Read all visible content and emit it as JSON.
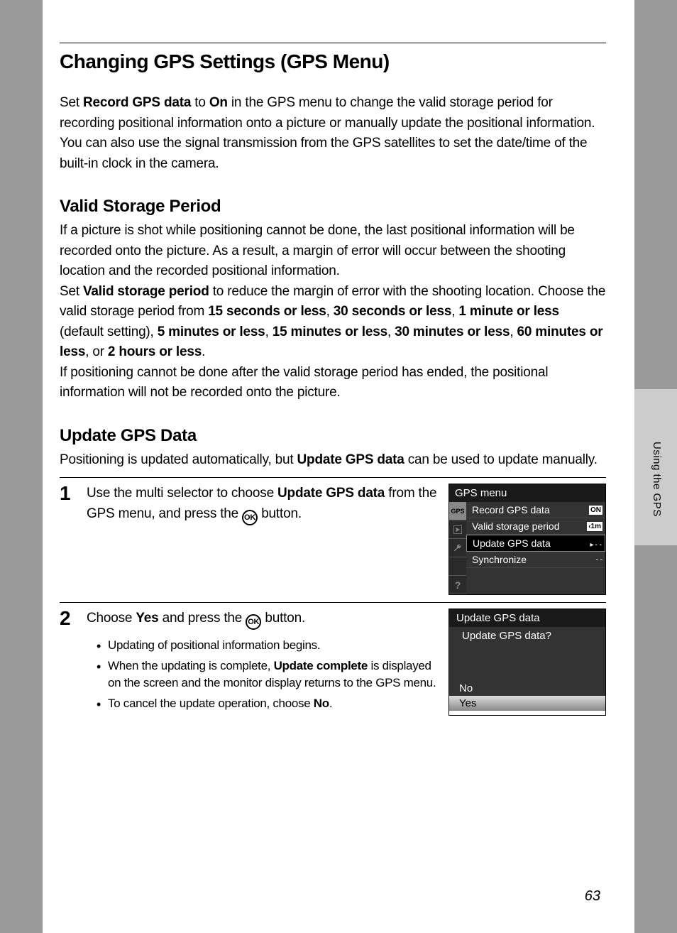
{
  "title": "Changing GPS Settings (GPS Menu)",
  "intro": {
    "pre": "Set ",
    "b1": "Record GPS data",
    "mid1": " to ",
    "b2": "On",
    "post": " in the GPS menu to change the valid storage period for recording positional information onto a picture or manually update the positional information. You can also use the signal transmission from the GPS satellites to set the date/time of the built-in clock in the camera."
  },
  "section1": {
    "heading": "Valid Storage Period",
    "p1": "If a picture is shot while positioning cannot be done, the last positional information will be recorded onto the picture. As a result, a margin of error will occur between the shooting location and the recorded positional information.",
    "p2_pre": "Set ",
    "p2_b1": "Valid storage period",
    "p2_mid": " to reduce the margin of error with the shooting location. Choose the valid storage period from ",
    "opt1": "15 seconds or less",
    "c1": ", ",
    "opt2": "30 seconds or less",
    "c2": ", ",
    "opt3": "1 minute or less",
    "def": " (default setting), ",
    "opt4": "5 minutes or less",
    "c4": ", ",
    "opt5": "15 minutes or less",
    "c5": ", ",
    "opt6": "30 minutes or less",
    "c6": ", ",
    "opt7": "60 minutes or less",
    "c7": ", or ",
    "opt8": "2 hours or less",
    "c8": ".",
    "p3": "If positioning cannot be done after the valid storage period has ended, the positional information will not be recorded onto the picture."
  },
  "section2": {
    "heading": "Update GPS Data",
    "p1_pre": "Positioning is updated automatically, but ",
    "p1_b": "Update GPS data",
    "p1_post": " can be used to update manually."
  },
  "step1": {
    "num": "1",
    "pre": "Use the multi selector to choose ",
    "b": "Update GPS data",
    "mid": " from the GPS menu, and press the ",
    "post": " button.",
    "ok": "OK"
  },
  "step2": {
    "num": "2",
    "pre": "Choose ",
    "b": "Yes",
    "mid": " and press the ",
    "post": " button.",
    "ok": "OK",
    "bullet1": "Updating of positional information begins.",
    "bullet2_pre": "When the updating is complete, ",
    "bullet2_b": "Update complete",
    "bullet2_post": " is displayed on the screen and the monitor display returns to the GPS menu.",
    "bullet3_pre": "To cancel the update operation, choose ",
    "bullet3_b": "No",
    "bullet3_post": "."
  },
  "screen1": {
    "title": "GPS menu",
    "tab_gps": "GPS",
    "tab_help": "?",
    "item1": "Record GPS data",
    "val1": "ON",
    "item2": "Valid storage period",
    "val2": "‹1m",
    "item3": "Update GPS data",
    "val3": "- -",
    "item4": "Synchronize",
    "val4": "- -"
  },
  "screen2": {
    "title": "Update GPS data",
    "prompt": "Update GPS data?",
    "no": "No",
    "yes": "Yes"
  },
  "side_label": "Using the GPS",
  "page_num": "63"
}
